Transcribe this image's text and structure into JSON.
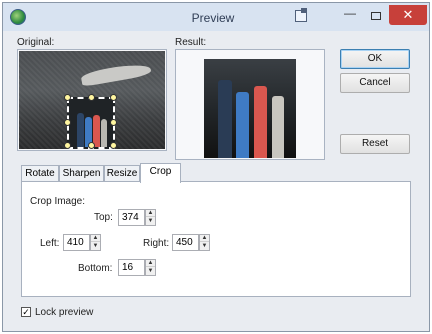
{
  "window": {
    "title": "Preview",
    "icons": {
      "app": "app-globe-icon",
      "extra": "window-pin-icon",
      "minimize": "minimize-icon",
      "maximize": "maximize-icon",
      "close": "close-icon"
    },
    "minimize_glyph": "—",
    "close_glyph": "✕"
  },
  "labels": {
    "original": "Original:",
    "result": "Result:"
  },
  "buttons": {
    "ok": "OK",
    "cancel": "Cancel",
    "reset": "Reset"
  },
  "tabs": [
    {
      "label": "Rotate",
      "active": false
    },
    {
      "label": "Sharpen",
      "active": false
    },
    {
      "label": "Resize",
      "active": false
    },
    {
      "label": "Crop",
      "active": true
    }
  ],
  "crop": {
    "heading": "Crop Image:",
    "top_label": "Top:",
    "top_value": "374",
    "left_label": "Left:",
    "left_value": "410",
    "right_label": "Right:",
    "right_value": "450",
    "bottom_label": "Bottom:",
    "bottom_value": "16"
  },
  "lock_preview": {
    "label": "Lock preview",
    "checked": true,
    "check_glyph": "✓"
  },
  "spinner_glyphs": {
    "up": "▲",
    "down": "▼"
  },
  "colors": {
    "close_button": "#c7403a",
    "titlebar": "#d8e3f1"
  }
}
